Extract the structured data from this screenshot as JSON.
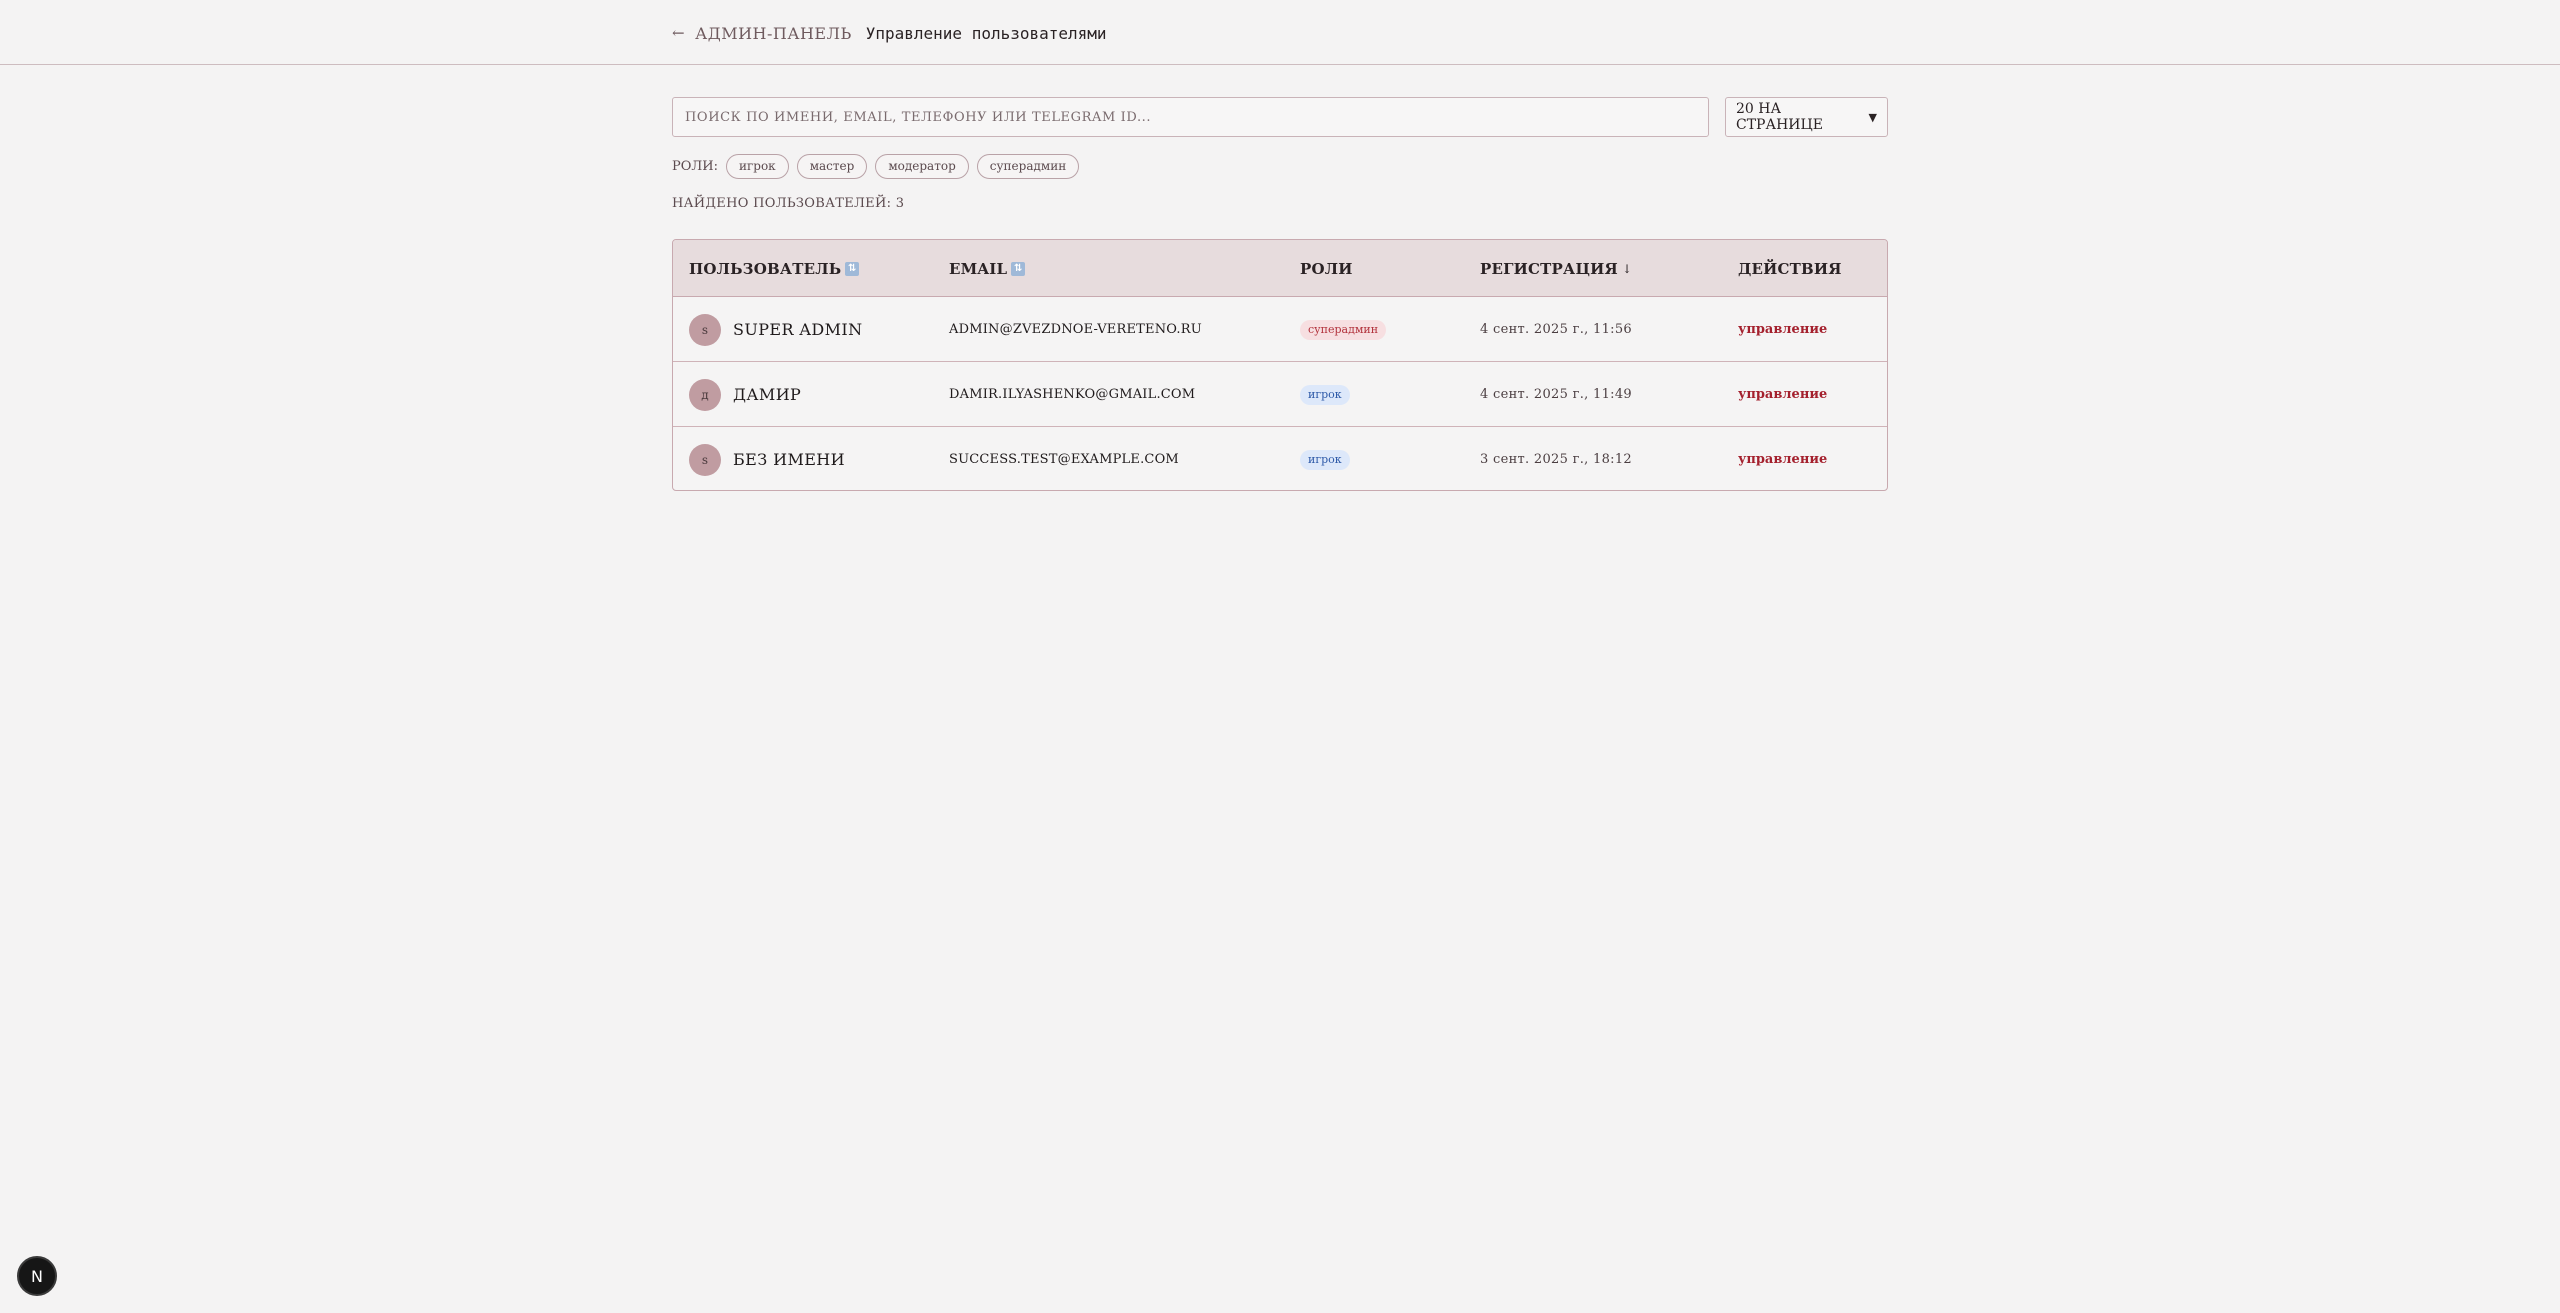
{
  "header": {
    "back_arrow": "←",
    "back_label": "админ-панель",
    "page_title": "Управление пользователями"
  },
  "search": {
    "placeholder": "поиск по имени, email, телефону или telegram id...",
    "value": ""
  },
  "per_page": {
    "selected": "20 на странице"
  },
  "roles_filter": {
    "label": "роли:",
    "chips": [
      "игрок",
      "мастер",
      "модератор",
      "суперадмин"
    ]
  },
  "found_text": "найдено пользователей: 3",
  "table": {
    "columns": {
      "user": "пользователь",
      "email": "email",
      "roles": "роли",
      "registration": "регистрация",
      "actions": "действия"
    },
    "sort_icon": "⇅",
    "sort_arrow": "↓",
    "rows": [
      {
        "avatar": "s",
        "name": "Super Admin",
        "email": "admin@zvezdnoe-vereteno.ru",
        "role": "суперадмин",
        "registered": "4 сент. 2025 г., 11:56",
        "action": "управление"
      },
      {
        "avatar": "д",
        "name": "Дамир",
        "email": "damir.ilyashenko@gmail.com",
        "role": "игрок",
        "registered": "4 сент. 2025 г., 11:49",
        "action": "управление"
      },
      {
        "avatar": "s",
        "name": "Без имени",
        "email": "success.test@example.com",
        "role": "игрок",
        "registered": "3 сент. 2025 г., 18:12",
        "action": "управление"
      }
    ]
  },
  "dev_badge": {
    "label": "N"
  },
  "colors": {
    "background": "#f4f3f3",
    "header_row": "#e7dcdd",
    "accent_red": "#a4202d",
    "superadmin_badge_bg": "#f7dfe1",
    "player_badge_bg": "#dde8fa"
  }
}
